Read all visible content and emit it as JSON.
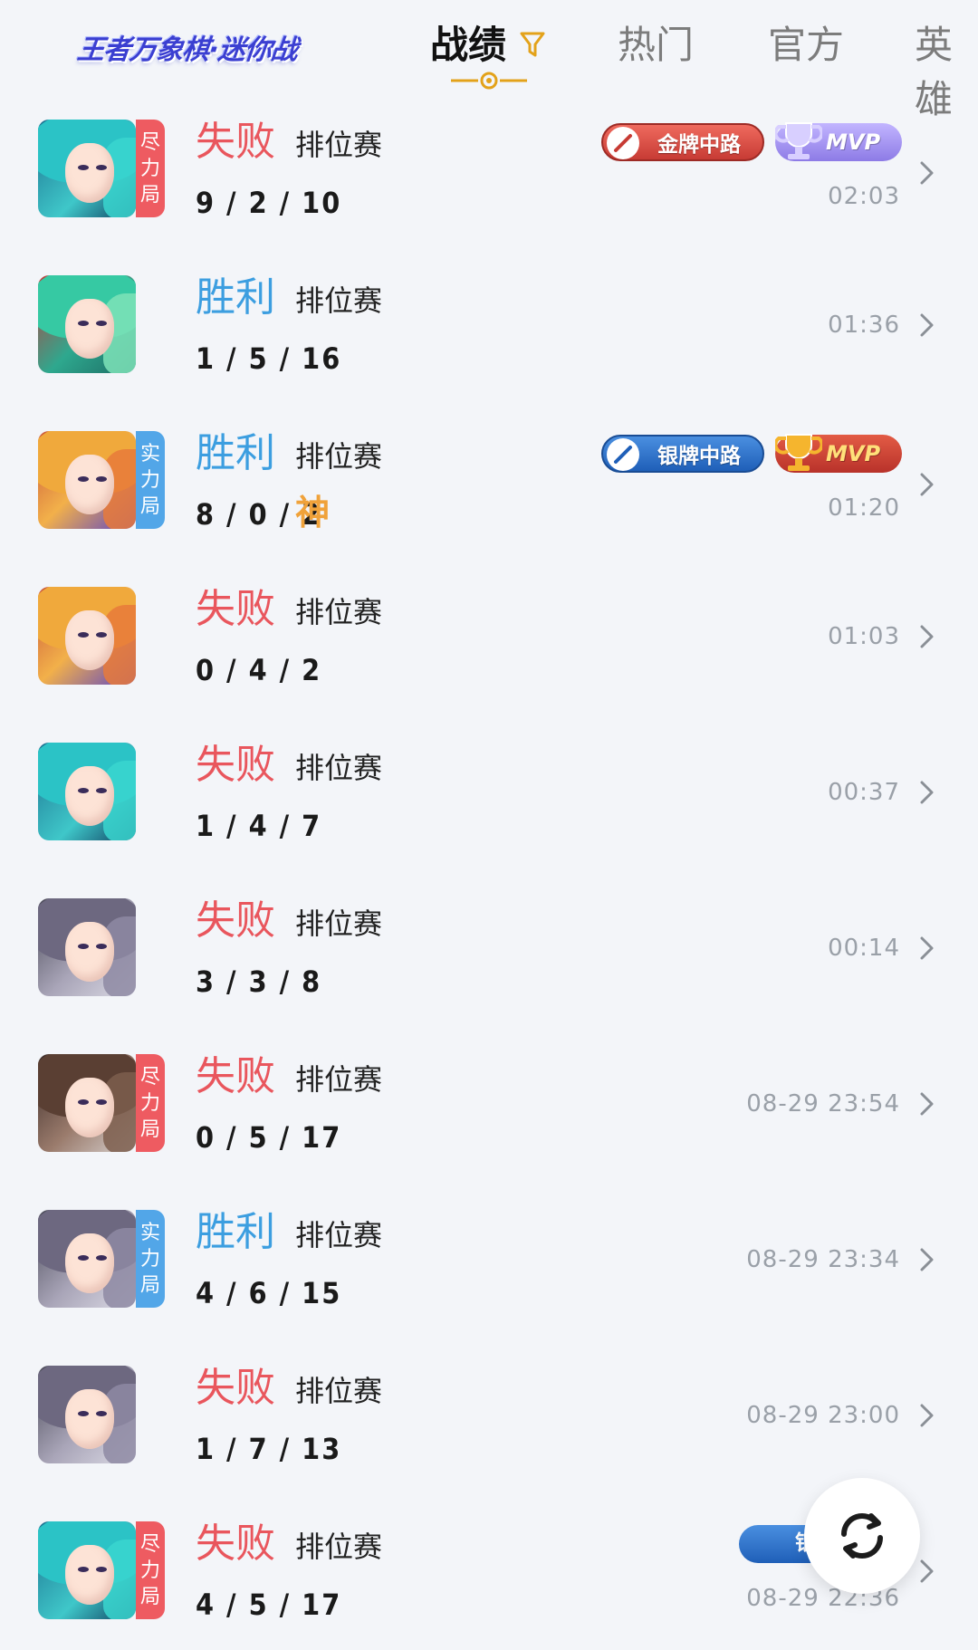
{
  "header": {
    "logo_text": "王者万象棋·迷你战",
    "tabs": [
      {
        "label": "战绩",
        "active": true
      },
      {
        "label": "热门",
        "active": false
      },
      {
        "label": "官方",
        "active": false
      },
      {
        "label": "英雄",
        "active": false
      }
    ]
  },
  "matches": [
    {
      "result": "失败",
      "outcome": "loss",
      "mode": "排位赛",
      "kda": "9 / 2 / 10",
      "time": "02:03",
      "tag": [
        "尽",
        "力",
        "局"
      ],
      "tag_color": "red",
      "hero": "teal",
      "lane_badge": {
        "label": "金牌中路",
        "color": "red"
      },
      "mvp_badge": {
        "label": "MVP",
        "color": "purple"
      }
    },
    {
      "result": "胜利",
      "outcome": "win",
      "mode": "排位赛",
      "kda": "1 / 5 / 16",
      "time": "01:36",
      "tag": [],
      "hero": "green"
    },
    {
      "result": "胜利",
      "outcome": "win",
      "mode": "排位赛",
      "kda": "8 / 0 / 2",
      "extra": "神",
      "time": "01:20",
      "tag": [
        "实",
        "力",
        "局"
      ],
      "tag_color": "blue",
      "hero": "gold",
      "lane_badge": {
        "label": "银牌中路",
        "color": "blue"
      },
      "mvp_badge": {
        "label": "MVP",
        "color": "gold"
      }
    },
    {
      "result": "失败",
      "outcome": "loss",
      "mode": "排位赛",
      "kda": "0 / 4 / 2",
      "time": "01:03",
      "tag": [],
      "hero": "gold"
    },
    {
      "result": "失败",
      "outcome": "loss",
      "mode": "排位赛",
      "kda": "1 / 4 / 7",
      "time": "00:37",
      "tag": [],
      "hero": "teal"
    },
    {
      "result": "失败",
      "outcome": "loss",
      "mode": "排位赛",
      "kda": "3 / 3 / 8",
      "time": "00:14",
      "tag": [],
      "hero": "gray"
    },
    {
      "result": "失败",
      "outcome": "loss",
      "mode": "排位赛",
      "kda": "0 / 5 / 17",
      "time": "08-29 23:54",
      "tag": [
        "尽",
        "力",
        "局"
      ],
      "tag_color": "red",
      "hero": "brown"
    },
    {
      "result": "胜利",
      "outcome": "win",
      "mode": "排位赛",
      "kda": "4 / 6 / 15",
      "time": "08-29 23:34",
      "tag": [
        "实",
        "力",
        "局"
      ],
      "tag_color": "blue",
      "hero": "gray"
    },
    {
      "result": "失败",
      "outcome": "loss",
      "mode": "排位赛",
      "kda": "1 / 7 / 13",
      "time": "08-29 23:00",
      "tag": [],
      "hero": "gray"
    },
    {
      "result": "失败",
      "outcome": "loss",
      "mode": "排位赛",
      "kda": "4 / 5 / 17",
      "time": "08-29 22:36",
      "tag": [
        "尽",
        "力",
        "局"
      ],
      "tag_color": "red",
      "hero": "teal",
      "partial_badge": "银"
    }
  ],
  "colors": {
    "loss": "#e9565d",
    "win": "#3c9ee0",
    "active_tab": "#111111",
    "tab_accent": "#e3a21a"
  },
  "icons": {
    "filter": "filter-icon",
    "refresh": "refresh-icon",
    "chevron": "chevron-right-icon"
  }
}
